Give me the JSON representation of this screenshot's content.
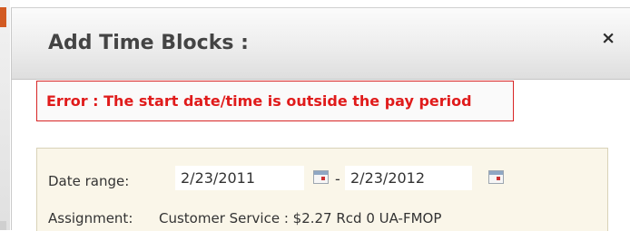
{
  "dialog": {
    "title": "Add Time Blocks :",
    "close_glyph": "×",
    "error": "Error : The start date/time is outside the pay period"
  },
  "form": {
    "date_range_label": "Date range:",
    "start_date": "2/23/2011",
    "separator": "-",
    "end_date": "2/23/2012",
    "assignment_label": "Assignment:",
    "assignment_value": "Customer Service : $2.27 Rcd 0 UA-FMOP"
  },
  "colors": {
    "error_red": "#e01b1b",
    "panel_background": "#faf6e9",
    "accent_orange": "#d25a22"
  },
  "icons": [
    "close-icon",
    "calendar-icon"
  ]
}
